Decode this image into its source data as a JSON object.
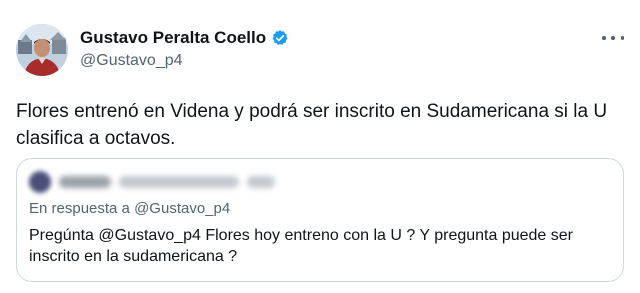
{
  "author": {
    "name": "Gustavo Peralta Coello",
    "handle": "@Gustavo_p4",
    "verified": true
  },
  "tweet": {
    "text": "Flores entrenó en Videna y podrá ser inscrito en Sudamericana si la U clasifica a octavos."
  },
  "quoted": {
    "reply_prefix": "En respuesta a ",
    "reply_handle": "@Gustavo_p4",
    "text": "Pregúnta @Gustavo_p4 Flores hoy entreno con la U ? Y pregunta puede ser inscrito en la sudamericana ?"
  },
  "colors": {
    "verified_blue": "#1d9bf0",
    "secondary_text": "#536471",
    "border": "#cfd9de"
  },
  "icons": {
    "verified": "verified-badge-icon",
    "more": "more-options-icon"
  }
}
